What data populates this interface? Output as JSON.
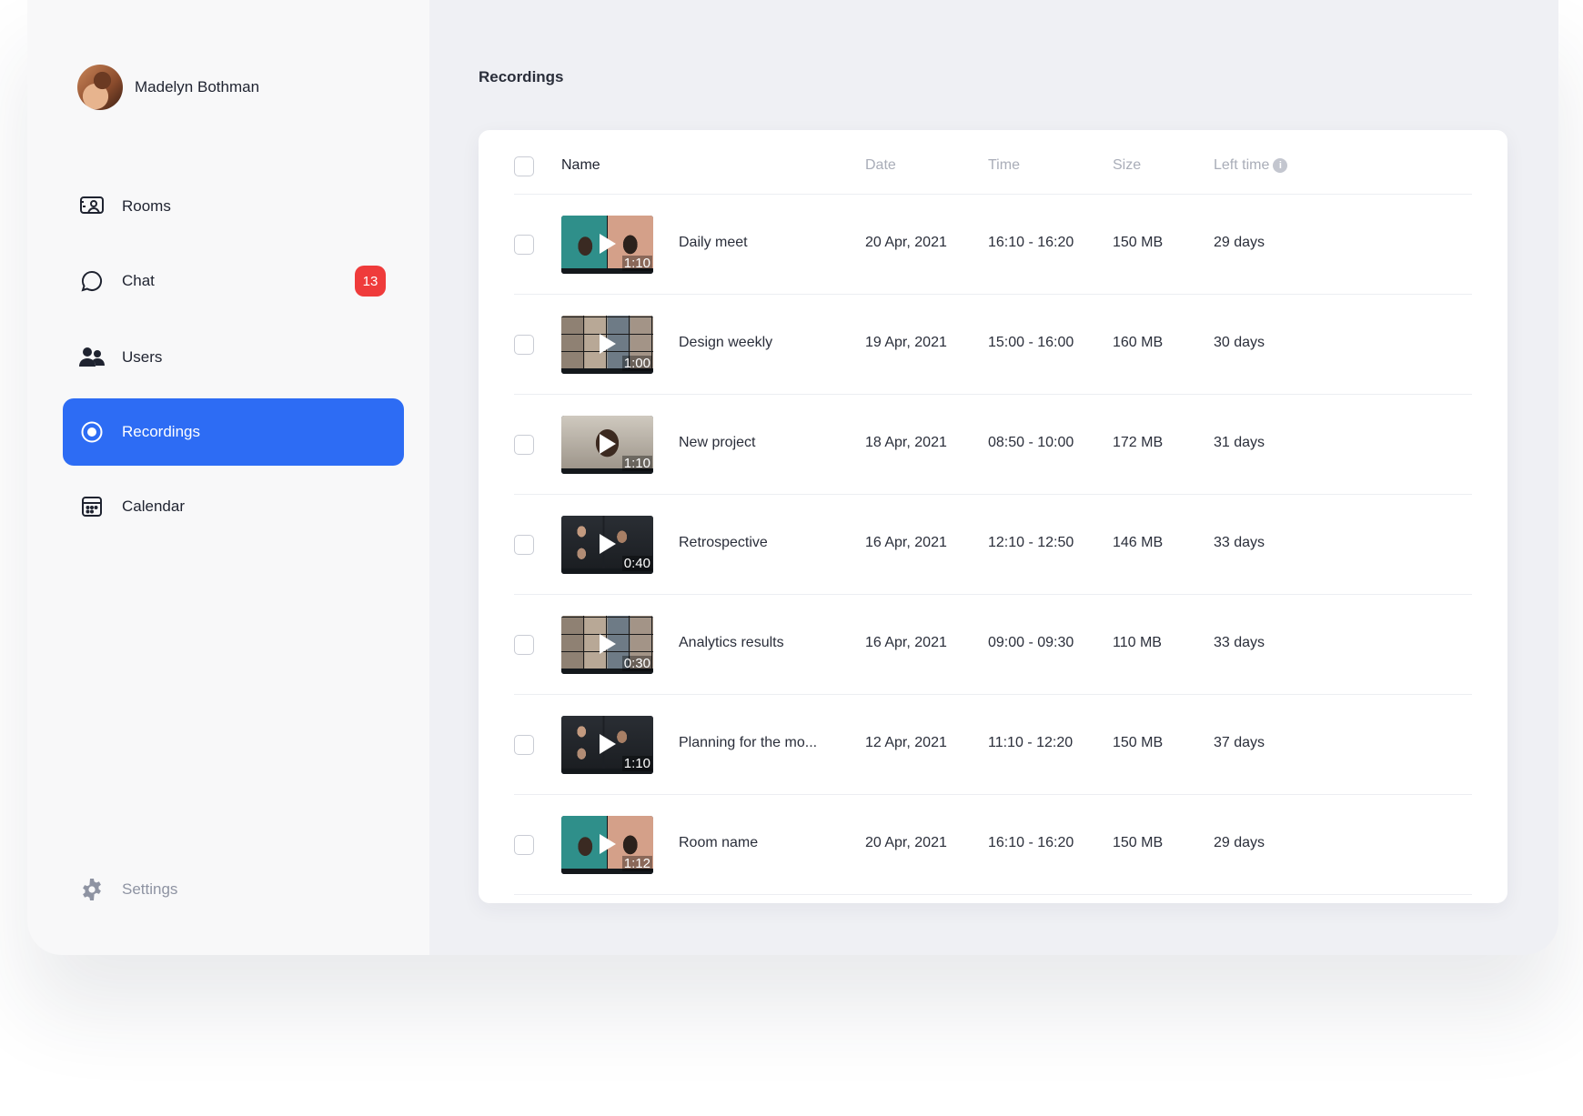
{
  "user": {
    "name": "Madelyn Bothman"
  },
  "nav": [
    {
      "label": "Rooms",
      "icon": "rooms-icon"
    },
    {
      "label": "Chat",
      "icon": "chat-icon",
      "badge": "13"
    },
    {
      "label": "Users",
      "icon": "users-icon"
    },
    {
      "label": "Recordings",
      "icon": "record-icon",
      "active": true
    },
    {
      "label": "Calendar",
      "icon": "calendar-icon"
    }
  ],
  "settings": {
    "label": "Settings",
    "icon": "gear-icon"
  },
  "colors": {
    "accent": "#2d6cf4",
    "badge": "#ef3b3b"
  },
  "page": {
    "title": "Recordings"
  },
  "table": {
    "headers": {
      "name": "Name",
      "date": "Date",
      "time": "Time",
      "size": "Size",
      "left_time": "Left time"
    },
    "rows": [
      {
        "name": "Daily meet",
        "date": "20 Apr, 2021",
        "time": "16:10 - 16:20",
        "size": "150 MB",
        "left_time": "29 days",
        "duration": "1:10"
      },
      {
        "name": "Design weekly",
        "date": "19 Apr, 2021",
        "time": "15:00 - 16:00",
        "size": "160 MB",
        "left_time": "30 days",
        "duration": "1:00"
      },
      {
        "name": "New project",
        "date": "18 Apr, 2021",
        "time": "08:50 - 10:00",
        "size": "172 MB",
        "left_time": "31 days",
        "duration": "1:10"
      },
      {
        "name": "Retrospective",
        "date": "16 Apr, 2021",
        "time": "12:10 - 12:50",
        "size": "146 MB",
        "left_time": "33 days",
        "duration": "0:40"
      },
      {
        "name": "Analytics results",
        "date": "16 Apr, 2021",
        "time": "09:00 - 09:30",
        "size": "110 MB",
        "left_time": "33 days",
        "duration": "0:30"
      },
      {
        "name": "Planning for the mo...",
        "date": "12 Apr, 2021",
        "time": "11:10 - 12:20",
        "size": "150 MB",
        "left_time": "37 days",
        "duration": "1:10"
      },
      {
        "name": "Room name",
        "date": "20 Apr, 2021",
        "time": "16:10 - 16:20",
        "size": "150 MB",
        "left_time": "29 days",
        "duration": "1:12"
      }
    ]
  }
}
